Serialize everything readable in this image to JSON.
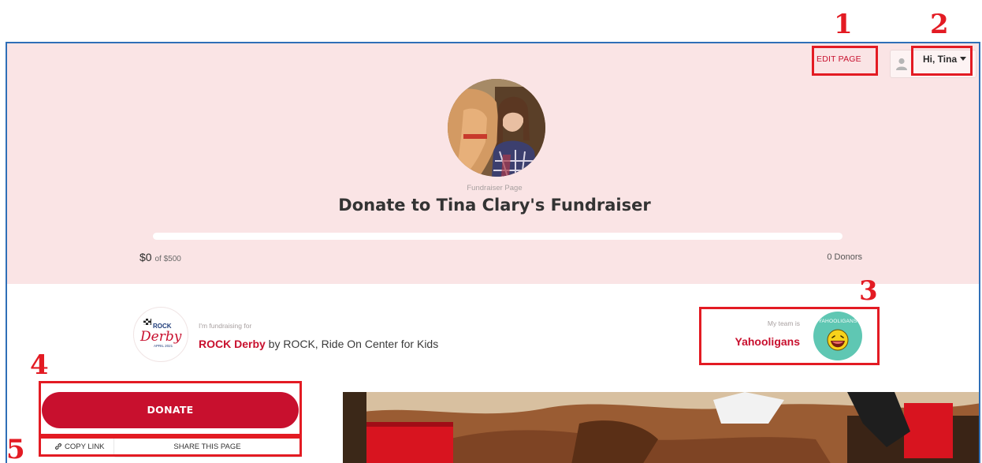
{
  "header": {
    "edit_page_label": "EDIT PAGE",
    "user_greeting": "Hi, Tina"
  },
  "hero": {
    "page_kind": "Fundraiser Page",
    "title": "Donate to Tina Clary's Fundraiser",
    "raised_amount": "$0",
    "goal_text": "of $500",
    "progress_fraction": 0,
    "donors_text": "0 Donors"
  },
  "event": {
    "fundraising_for_label": "I'm fundraising for",
    "event_name": "ROCK Derby",
    "organizer_text": " by ROCK, Ride On Center for Kids",
    "logo_text_top": "ROCK",
    "logo_text_script": "Derby",
    "logo_text_date": "APRIL 2021"
  },
  "team": {
    "label": "My team is",
    "name": "Yahooligans",
    "badge_text": "YAHOOLIGANS"
  },
  "actions": {
    "donate_label": "DONATE",
    "copy_link_label": "COPY LINK",
    "share_label": "SHARE THIS PAGE"
  },
  "annotations": {
    "n1": "1",
    "n2": "2",
    "n3": "3",
    "n4": "4",
    "n5": "5"
  },
  "colors": {
    "brand_red": "#c8102e",
    "hero_pink": "#fae4e5",
    "annotation_red": "#e31b23",
    "team_teal": "#5fc7b3",
    "frame_blue": "#2f6fb7"
  },
  "icons": {
    "user": "user-avatar-icon",
    "caret": "caret-down-icon",
    "link": "link-icon"
  }
}
